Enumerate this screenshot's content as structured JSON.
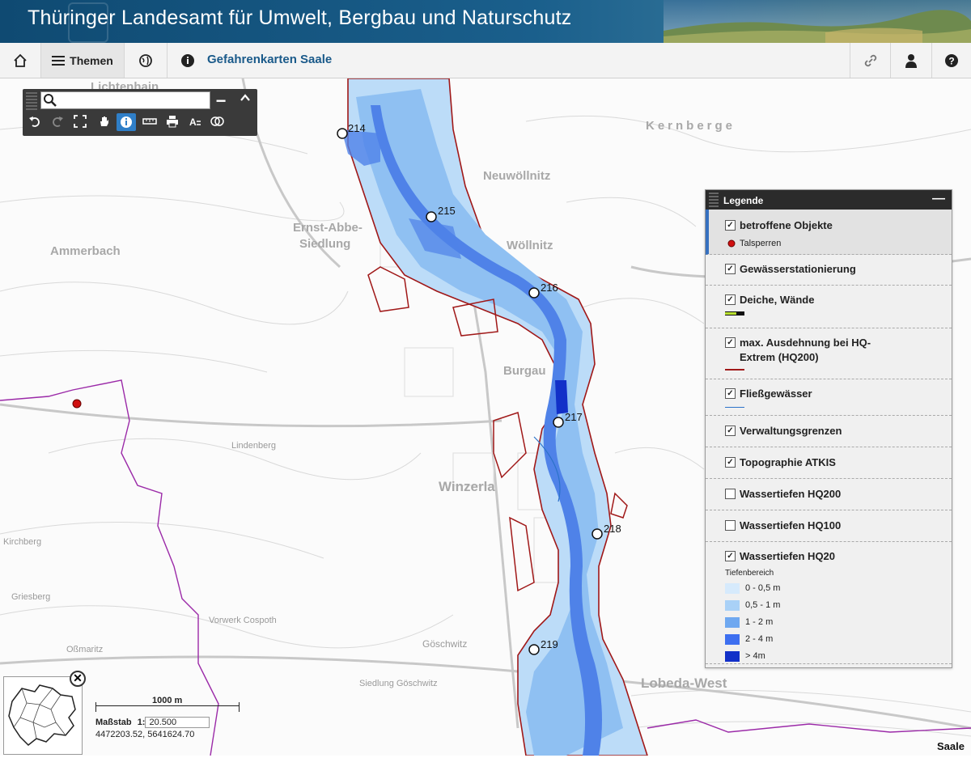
{
  "banner": {
    "title": "Thüringer Landesamt für Umwelt, Bergbau und Naturschutz"
  },
  "toolbar": {
    "home_icon": "home-icon",
    "themes_label": "Themen",
    "globe_icon": "globe-icon",
    "info_icon": "info-icon",
    "app_title": "Gefahrenkarten Saale",
    "link_icon": "link-icon",
    "user_icon": "user-icon",
    "help_icon": "help-icon"
  },
  "search": {
    "placeholder": ""
  },
  "legend": {
    "title": "Legende",
    "items": [
      {
        "label": "betroffene Objekte",
        "checked": true,
        "sub": "Talsperren"
      },
      {
        "label": "Gewässerstationierung",
        "checked": true
      },
      {
        "label": "Deiche, Wände",
        "checked": true
      },
      {
        "label": "max. Ausdehnung bei HQ-",
        "label2": "Extrem (HQ200)",
        "checked": true
      },
      {
        "label": "Fließgewässer",
        "checked": true
      },
      {
        "label": "Verwaltungsgrenzen",
        "checked": true
      },
      {
        "label": "Topographie ATKIS",
        "checked": true
      },
      {
        "label": "Wassertiefen HQ200",
        "checked": false
      },
      {
        "label": "Wassertiefen HQ100",
        "checked": false
      },
      {
        "label": "Wassertiefen HQ20",
        "checked": true
      }
    ],
    "depth_title": "Tiefenbereich",
    "depth_classes": [
      {
        "label": "0 - 0,5 m",
        "color": "#d6eafc"
      },
      {
        "label": "0,5 - 1 m",
        "color": "#a9d1f7"
      },
      {
        "label": "1 - 2 m",
        "color": "#6fa8f0"
      },
      {
        "label": "2 - 4 m",
        "color": "#3d6ff0"
      },
      {
        "label": "> 4m",
        "color": "#1230c8"
      }
    ]
  },
  "stations": [
    "214",
    "215",
    "216",
    "217",
    "218",
    "219"
  ],
  "map_labels": {
    "lichtenhain": "Lichtenhain",
    "ammerbach": "Ammerbach",
    "ernst_abbe": "Ernst-Abbe-",
    "siedlung": "Siedlung",
    "neuwoellnitz": "Neuwöllnitz",
    "woellnitz": "Wöllnitz",
    "kernberge": "Kernberge",
    "burgau": "Burgau",
    "winzerla": "Winzerla",
    "lobeda_west": "Lobeda-West",
    "goeschwitz": "Göschwitz",
    "saale": "Saale",
    "siedlung_goeschwitz": "Siedlung Göschwitz",
    "vorwerk_cospoth": "Vorwerk Cospoth",
    "griesberg": "Griesberg",
    "kirchberg": "Kirchberg",
    "lindenberg": "Lindenberg",
    "ossmaritz": "Oßmaritz"
  },
  "scale": {
    "bar_label": "1000 m",
    "massstab_label": "Maßstab",
    "ratio_prefix": "1:",
    "ratio_value": "20.500",
    "coordinates": "4472203.52, 5641624.70"
  },
  "colors": {
    "accent": "#1a5a8a",
    "flood_outline": "#a01818",
    "admin_boundary": "#9b2aa8",
    "river": "#2b72c9"
  }
}
